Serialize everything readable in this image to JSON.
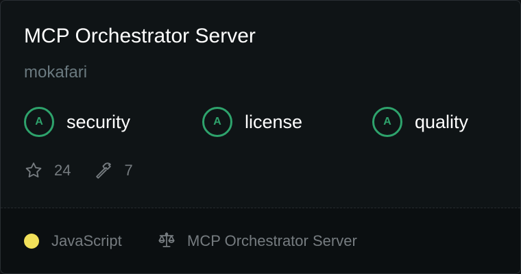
{
  "server": {
    "title": "MCP Orchestrator Server",
    "author": "mokafari"
  },
  "badges": [
    {
      "grade": "A",
      "label": "security"
    },
    {
      "grade": "A",
      "label": "license"
    },
    {
      "grade": "A",
      "label": "quality"
    }
  ],
  "stats": {
    "stars": "24",
    "tools": "7",
    "star_icon": "star-icon",
    "tools_icon": "hammer-icon"
  },
  "footer": {
    "language": "JavaScript",
    "language_color": "#f1e05a",
    "license": "MCP Orchestrator Server",
    "license_icon": "scale-icon"
  },
  "colors": {
    "grade_accent": "#2ea36c",
    "background": "#0f1416"
  }
}
